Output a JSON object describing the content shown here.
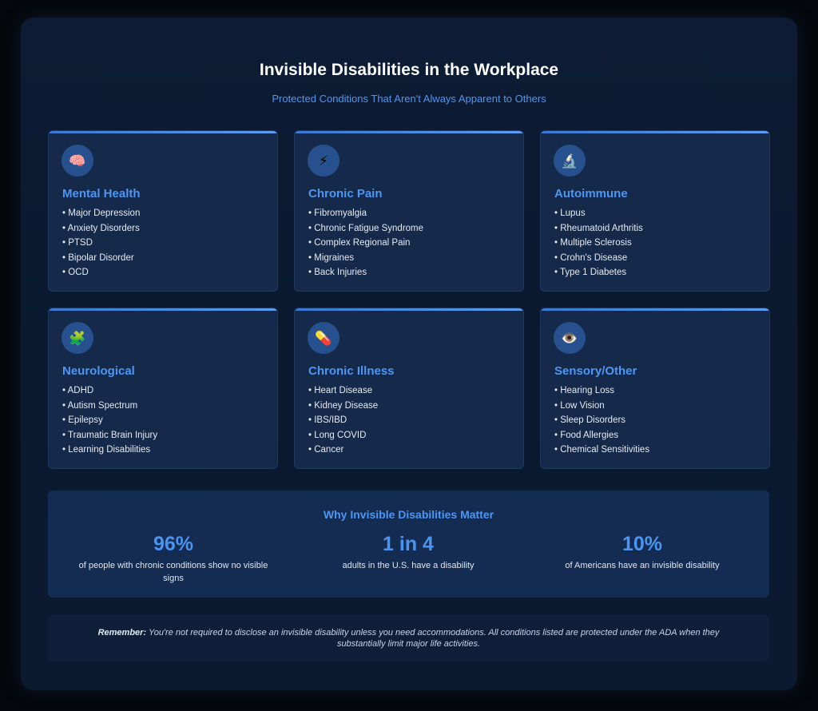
{
  "header": {
    "title": "Invisible Disabilities in the Workplace",
    "subtitle": "Protected Conditions That Aren't Always Apparent to Others"
  },
  "cards": [
    {
      "icon": "🧠",
      "icon_name": "brain-icon",
      "title": "Mental Health",
      "items": [
        "Major Depression",
        "Anxiety Disorders",
        "PTSD",
        "Bipolar Disorder",
        "OCD"
      ]
    },
    {
      "icon": "⚡",
      "icon_name": "lightning-icon",
      "title": "Chronic Pain",
      "items": [
        "Fibromyalgia",
        "Chronic Fatigue Syndrome",
        "Complex Regional Pain",
        "Migraines",
        "Back Injuries"
      ]
    },
    {
      "icon": "🔬",
      "icon_name": "microscope-icon",
      "title": "Autoimmune",
      "items": [
        "Lupus",
        "Rheumatoid Arthritis",
        "Multiple Sclerosis",
        "Crohn's Disease",
        "Type 1 Diabetes"
      ]
    },
    {
      "icon": "🧩",
      "icon_name": "puzzle-icon",
      "title": "Neurological",
      "items": [
        "ADHD",
        "Autism Spectrum",
        "Epilepsy",
        "Traumatic Brain Injury",
        "Learning Disabilities"
      ]
    },
    {
      "icon": "💊",
      "icon_name": "pill-icon",
      "title": "Chronic Illness",
      "items": [
        "Heart Disease",
        "Kidney Disease",
        "IBS/IBD",
        "Long COVID",
        "Cancer"
      ]
    },
    {
      "icon": "👁️",
      "icon_name": "eye-icon",
      "title": "Sensory/Other",
      "items": [
        "Hearing Loss",
        "Low Vision",
        "Sleep Disorders",
        "Food Allergies",
        "Chemical Sensitivities"
      ]
    }
  ],
  "stats": {
    "title": "Why Invisible Disabilities Matter",
    "items": [
      {
        "value": "96%",
        "desc": "of people with chronic conditions show no visible signs"
      },
      {
        "value": "1 in 4",
        "desc": "adults in the U.S. have a disability"
      },
      {
        "value": "10%",
        "desc": "of Americans have an invisible disability"
      }
    ]
  },
  "note": {
    "label": "Remember:",
    "text": "You're not required to disclose an invisible disability unless you need accommodations. All conditions listed are protected under the ADA when they substantially limit major life activities."
  },
  "colors": {
    "accent": "#4d97f3",
    "card_bg": "#15294a",
    "page_bg": "#0d1c34"
  }
}
